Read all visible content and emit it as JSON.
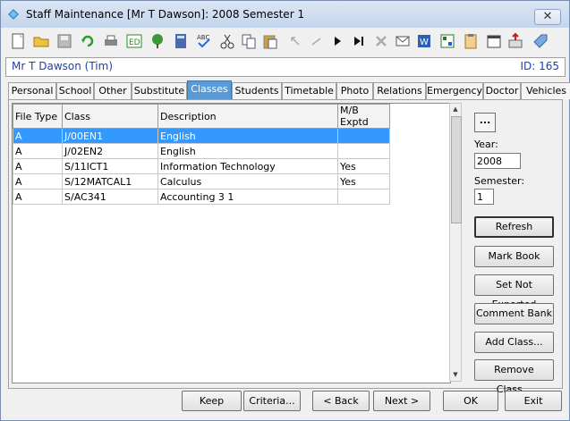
{
  "window": {
    "title": "Staff Maintenance  [Mr T Dawson]: 2008 Semester 1",
    "close_symbol": "✕"
  },
  "toolbar": {
    "icons": [
      "new-icon",
      "open-folder-icon",
      "save-icon",
      "refresh-icon",
      "print-icon",
      "edit-icon",
      "tree-icon",
      "calculator-icon",
      "spellcheck-icon",
      "cut-icon",
      "copy-icon",
      "paste-icon",
      "undo-icon",
      "redo-icon",
      "next-icon",
      "last-icon",
      "delete-icon",
      "email-icon",
      "word-icon",
      "grid-icon",
      "clipboard-icon",
      "calendar-icon",
      "export-icon",
      "tag-icon"
    ]
  },
  "header": {
    "name": "Mr T Dawson (Tim)",
    "id_label": "ID: 165"
  },
  "tabs": [
    "Personal",
    "School",
    "Other",
    "Substitute",
    "Classes",
    "Students",
    "Timetable",
    "Photo",
    "Relations",
    "Emergency",
    "Doctor",
    "Vehicles"
  ],
  "active_tab": "Classes",
  "grid": {
    "columns": [
      "File Type",
      "Class",
      "Description",
      "M/B Exptd"
    ],
    "rows": [
      [
        "A",
        "J/00EN1",
        "English",
        ""
      ],
      [
        "A",
        "J/02EN2",
        "English",
        ""
      ],
      [
        "A",
        "S/11ICT1",
        "Information Technology",
        "Yes"
      ],
      [
        "A",
        "S/12MATCAL1",
        "Calculus",
        "Yes"
      ],
      [
        "A",
        "S/AC341",
        "Accounting 3 1",
        ""
      ]
    ],
    "selected_row": 0
  },
  "side": {
    "ellipsis": "...",
    "year_label": "Year:",
    "year_value": "2008",
    "semester_label": "Semester:",
    "semester_value": "1",
    "refresh": "Refresh",
    "mark_book": "Mark Book",
    "set_not_exported": "Set Not Exported",
    "comment_bank": "Comment Bank",
    "add_class": "Add Class...",
    "remove_class": "Remove Class..."
  },
  "buttons": {
    "keep": "Keep",
    "criteria": "Criteria...",
    "back": "< Back",
    "next": "Next >",
    "ok": "OK",
    "exit": "Exit"
  }
}
